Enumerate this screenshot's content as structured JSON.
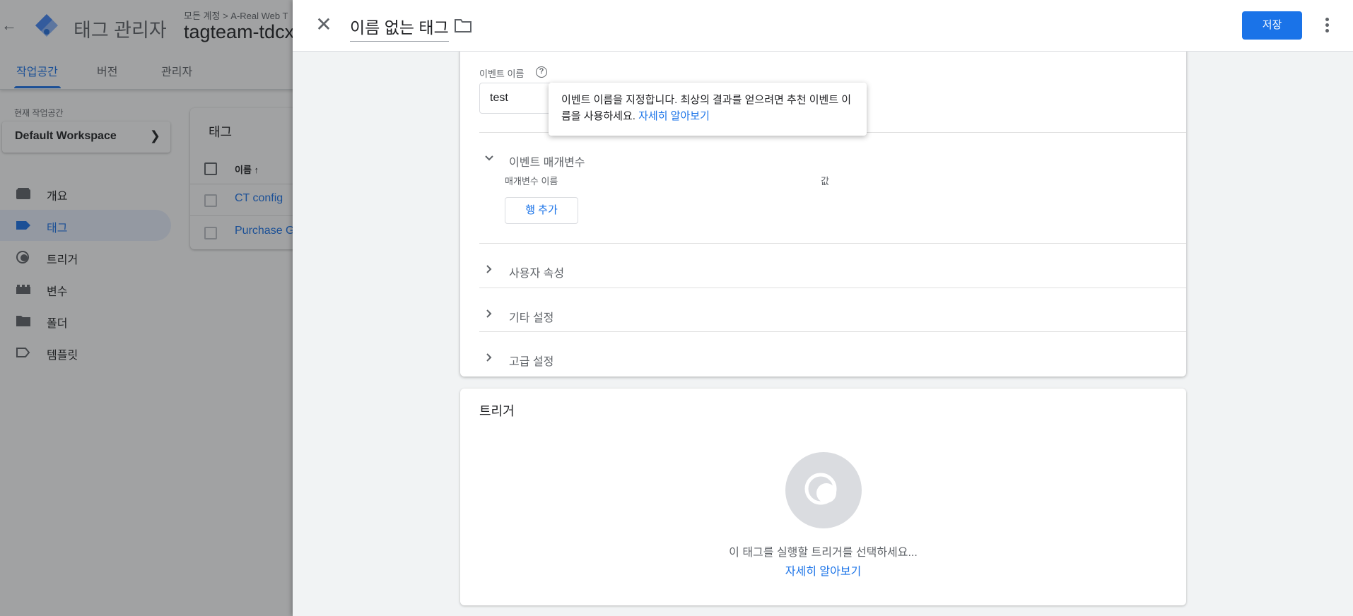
{
  "app": {
    "title": "태그 관리자",
    "breadcrumb": "모든 계정 > A-Real Web T",
    "container_name": "tagteam-tdcx",
    "nav_tabs": [
      {
        "label": "작업공간",
        "active": true
      },
      {
        "label": "버전",
        "active": false
      },
      {
        "label": "관리자",
        "active": false
      }
    ],
    "workspace_label": "현재 작업공간",
    "workspace_name": "Default Workspace",
    "sidebar": [
      {
        "label": "개요",
        "icon": "overview-icon"
      },
      {
        "label": "태그",
        "icon": "tag-icon",
        "active": true
      },
      {
        "label": "트리거",
        "icon": "trigger-icon"
      },
      {
        "label": "변수",
        "icon": "variables-icon"
      },
      {
        "label": "폴더",
        "icon": "folder-icon"
      },
      {
        "label": "템플릿",
        "icon": "template-icon"
      }
    ],
    "tags_panel": {
      "title": "태그",
      "column_name": "이름 ↑",
      "rows": [
        "CT config",
        "Purchase G"
      ]
    }
  },
  "sheet": {
    "title": "이름 없는 태그",
    "save_label": "저장",
    "event_name_label": "이벤트 이름",
    "event_name_value": "test",
    "tooltip_text": "이벤트 이름을 지정합니다. 최상의 결과를 얻으려면 추천 이벤트 이름을 사용하세요.",
    "tooltip_link": "자세히 알아보기",
    "sections": {
      "event_params": "이벤트 매개변수",
      "param_name_header": "매개변수 이름",
      "value_header": "값",
      "add_row": "행 추가",
      "user_properties": "사용자 속성",
      "other_settings": "기타 설정",
      "advanced_settings": "고급 설정"
    },
    "trigger": {
      "title": "트리거",
      "hint": "이 태그를 실행할 트리거를 선택하세요...",
      "link": "자세히 알아보기"
    }
  },
  "colors": {
    "accent": "#1a73e8",
    "overlay": "#9aa0a6",
    "sheet_background": "#f1f3f4"
  }
}
